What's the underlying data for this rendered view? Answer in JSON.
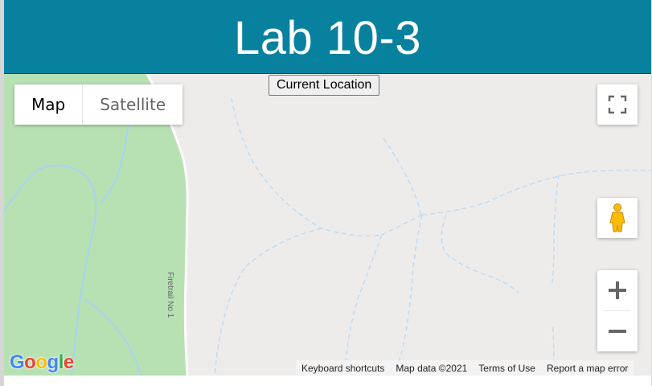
{
  "page": {
    "title": "Lab 10-3"
  },
  "toolbar": {
    "current_location_label": "Current Location"
  },
  "map": {
    "type_control": {
      "map_label": "Map",
      "satellite_label": "Satellite",
      "selected": "Map"
    },
    "road_label": "Firetrail No 1",
    "logo": {
      "letters": [
        "G",
        "o",
        "o",
        "g",
        "l",
        "e"
      ]
    },
    "attribution": {
      "keyboard_shortcuts": "Keyboard shortcuts",
      "map_data": "Map data ©2021",
      "terms": "Terms of Use",
      "report": "Report a map error"
    },
    "icons": {
      "fullscreen": "fullscreen-icon",
      "pegman": "pegman-icon",
      "zoom_in": "plus-icon",
      "zoom_out": "minus-icon"
    }
  },
  "colors": {
    "header_bg": "#08819f",
    "map_bg": "#eeecea",
    "park_green": "#b7e1b2",
    "stream_blue": "#a9d3f2",
    "logo": [
      "#4285F4",
      "#EA4335",
      "#FBBC05",
      "#4285F4",
      "#34A853",
      "#EA4335"
    ]
  }
}
